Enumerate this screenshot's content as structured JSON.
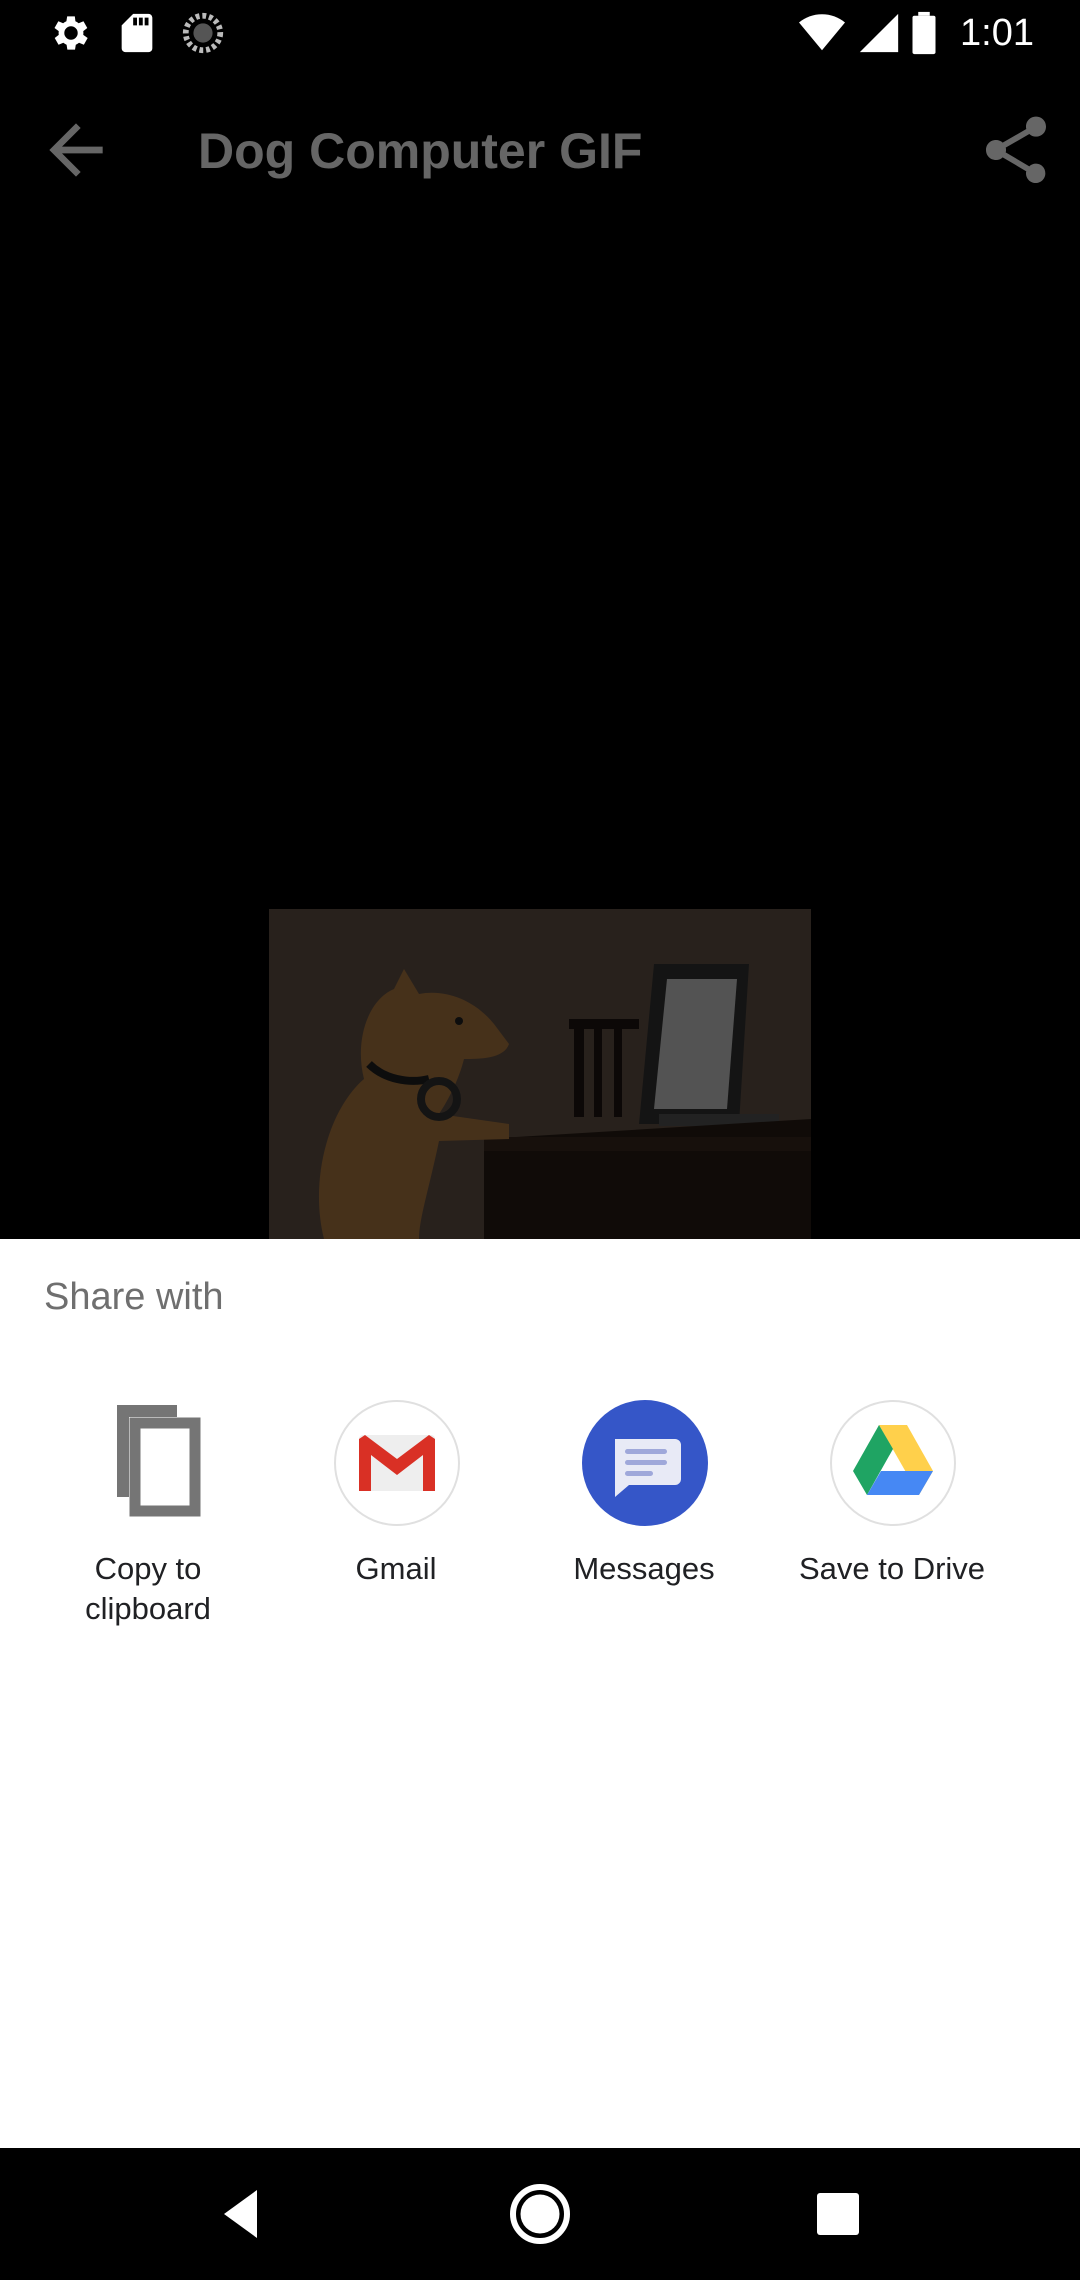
{
  "status_bar": {
    "time": "1:01",
    "icons": [
      "settings-icon",
      "sd-card-icon",
      "sync-circle-icon",
      "wifi-icon",
      "signal-icon",
      "battery-icon"
    ]
  },
  "app_bar": {
    "title": "Dog Computer GIF",
    "back_icon": "arrow-back-icon",
    "share_icon": "share-icon"
  },
  "share_sheet": {
    "title": "Share with",
    "targets": [
      {
        "label": "Copy to\nclipboard",
        "icon": "copy-icon"
      },
      {
        "label": "Gmail",
        "icon": "gmail-icon"
      },
      {
        "label": "Messages",
        "icon": "messages-icon"
      },
      {
        "label": "Save to Drive",
        "icon": "drive-icon"
      }
    ]
  },
  "nav_bar": {
    "icons": [
      "back-triangle-icon",
      "home-circle-icon",
      "recents-square-icon"
    ]
  },
  "colors": {
    "sheet_background": "#ffffff",
    "sheet_title": "#6f6f6f",
    "label": "#202124",
    "gmail_red": "#d93025",
    "messages_blue": "#3556c8",
    "drive_green": "#1fa463",
    "drive_yellow": "#ffd04b",
    "drive_blue": "#4688f4"
  }
}
